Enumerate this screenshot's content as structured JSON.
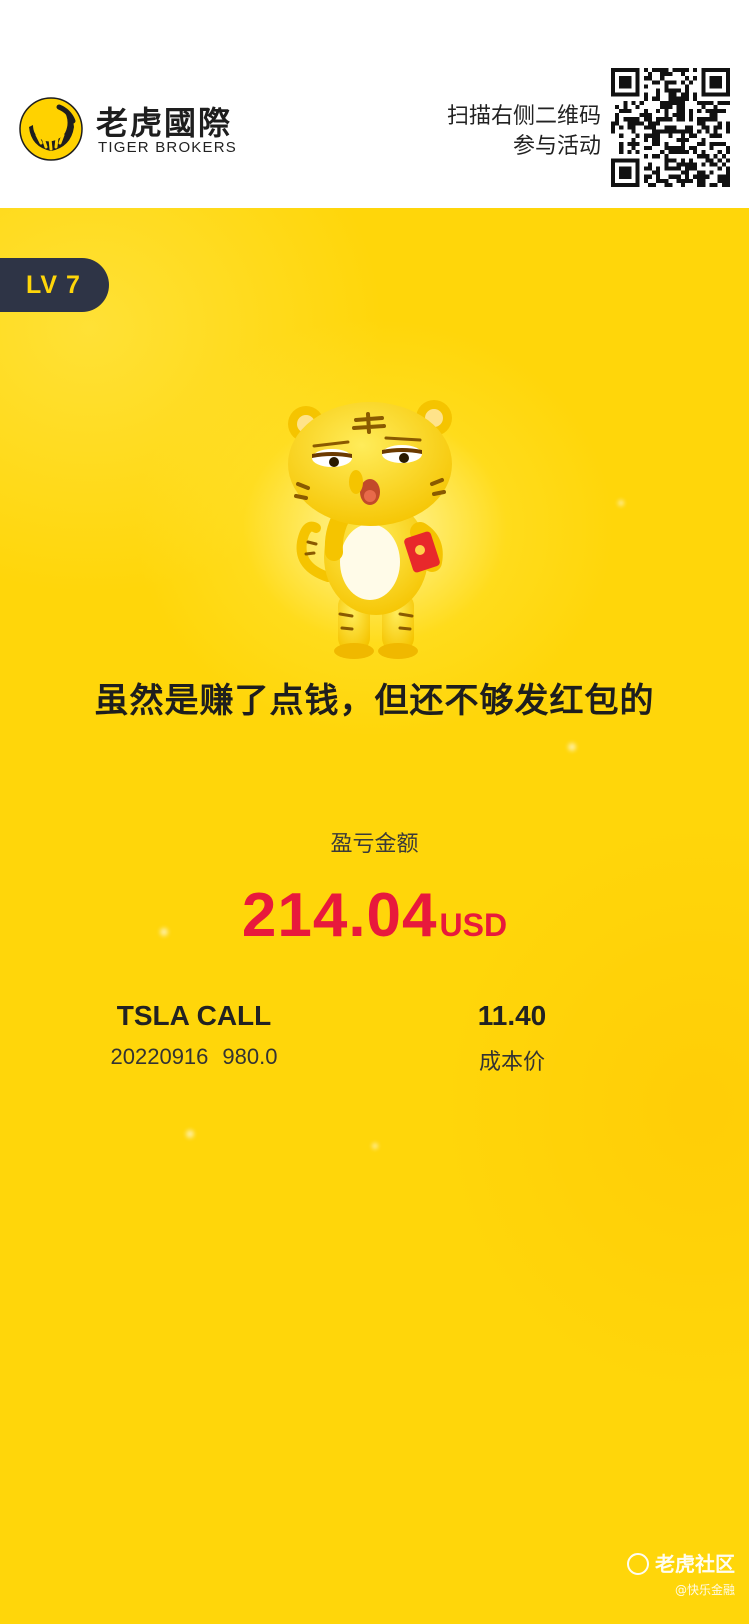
{
  "header": {
    "brand_cn": "老虎國際",
    "brand_en": "TIGER BROKERS",
    "scan_line1": "扫描右侧二维码",
    "scan_line2": "参与活动"
  },
  "card": {
    "level": "LV 7",
    "headline": "虽然是赚了点钱，但还不够发红包的",
    "pl_label": "盈亏金额",
    "pl_amount": "214.04",
    "pl_currency": "USD",
    "contract_name": "TSLA CALL",
    "contract_expiry": "20220916",
    "contract_strike": "980.0",
    "cost_value": "11.40",
    "cost_label": "成本价"
  },
  "watermark": {
    "line1": "老虎社区",
    "line2": "@快乐金融"
  },
  "colors": {
    "background": "#ffd60a",
    "profit": "#e8193c",
    "badge": "#2e3446"
  },
  "icons": [
    "tiger-logo-icon",
    "qr-code",
    "tiger-mascot",
    "red-envelope-icon",
    "watermark-logo-icon"
  ]
}
